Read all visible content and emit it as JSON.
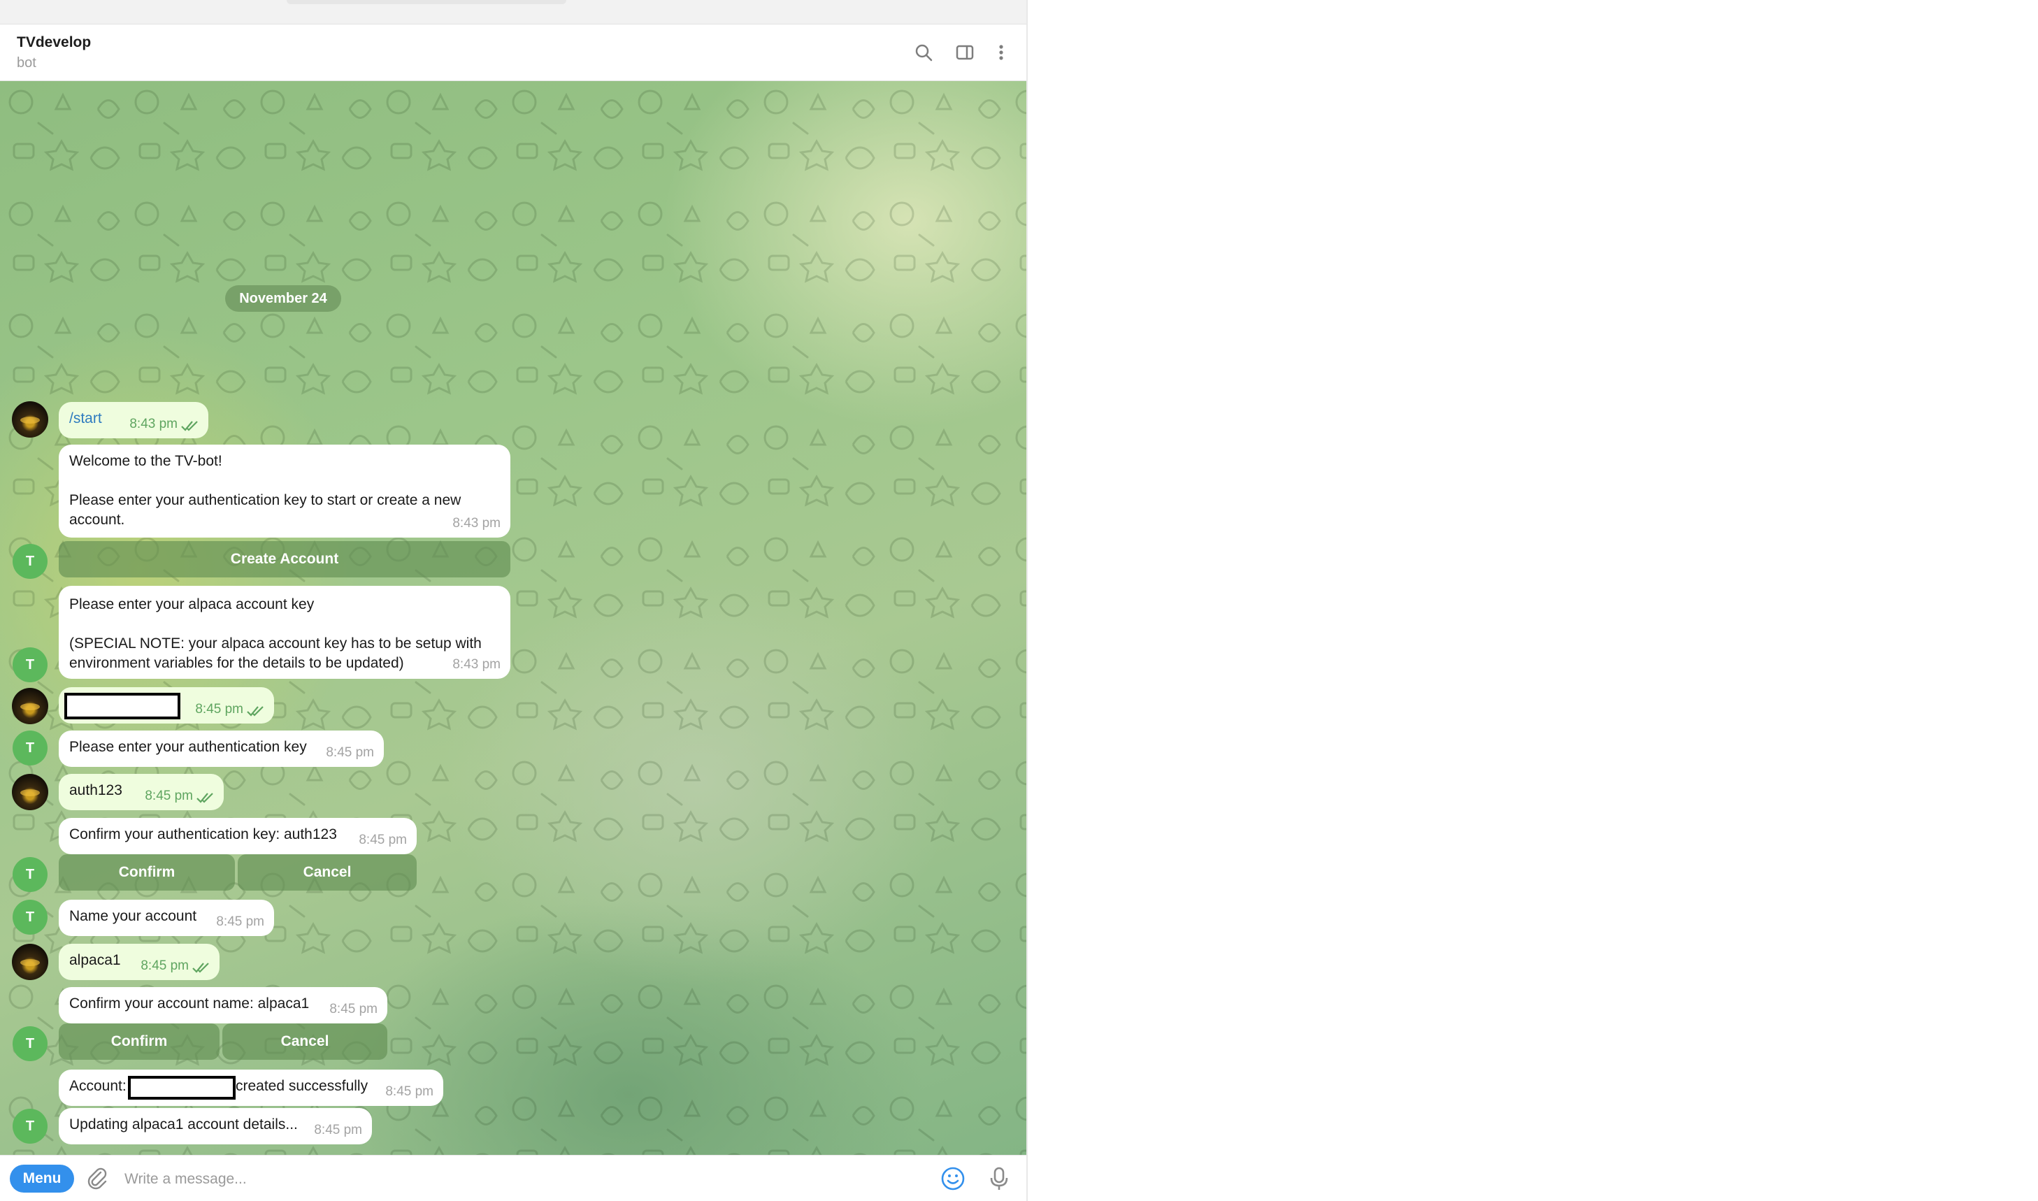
{
  "header": {
    "title": "TVdevelop",
    "subtitle": "bot"
  },
  "date_separator": "November 24",
  "bot_avatar_letter": "T",
  "messages": [
    {
      "text": "/start",
      "time": "8:43 pm"
    },
    {
      "line1": "Welcome to the TV-bot!",
      "line2": "Please enter your authentication key to start or create a new",
      "line3": "account.",
      "time": "8:43 pm",
      "button": "Create Account"
    },
    {
      "line1": "Please enter your alpaca account key",
      "line2": "(SPECIAL NOTE: your alpaca account key has to be setup with",
      "line3": "environment variables for the details to be updated)",
      "time": "8:43 pm"
    },
    {
      "time": "8:45 pm"
    },
    {
      "text": "Please enter your authentication key",
      "time": "8:45 pm"
    },
    {
      "text": "auth123",
      "time": "8:45 pm"
    },
    {
      "text": "Confirm your authentication key: auth123",
      "time": "8:45 pm",
      "confirm": "Confirm",
      "cancel": "Cancel"
    },
    {
      "text": "Name your account",
      "time": "8:45 pm"
    },
    {
      "text": "alpaca1",
      "time": "8:45 pm"
    },
    {
      "text": "Confirm your account name: alpaca1",
      "time": "8:45 pm",
      "confirm": "Confirm",
      "cancel": "Cancel"
    },
    {
      "prefix": "Account:",
      "suffix": "created successfully",
      "time": "8:45 pm"
    },
    {
      "text": "Updating alpaca1 account details...",
      "time": "8:45 pm"
    }
  ],
  "composer": {
    "menu_label": "Menu",
    "placeholder": "Write a message..."
  },
  "icons": {
    "search": "search-icon",
    "sidebar": "sidebar-toggle-icon",
    "more": "more-vertical-icon",
    "attach": "paperclip-icon",
    "emoji": "emoji-icon",
    "mic": "microphone-icon",
    "read": "double-check-icon"
  },
  "colors": {
    "accent": "#3390ec",
    "outgoing_bubble": "#effdde",
    "bot_avatar": "#5cb85c",
    "outgoing_time": "#5fa560"
  }
}
